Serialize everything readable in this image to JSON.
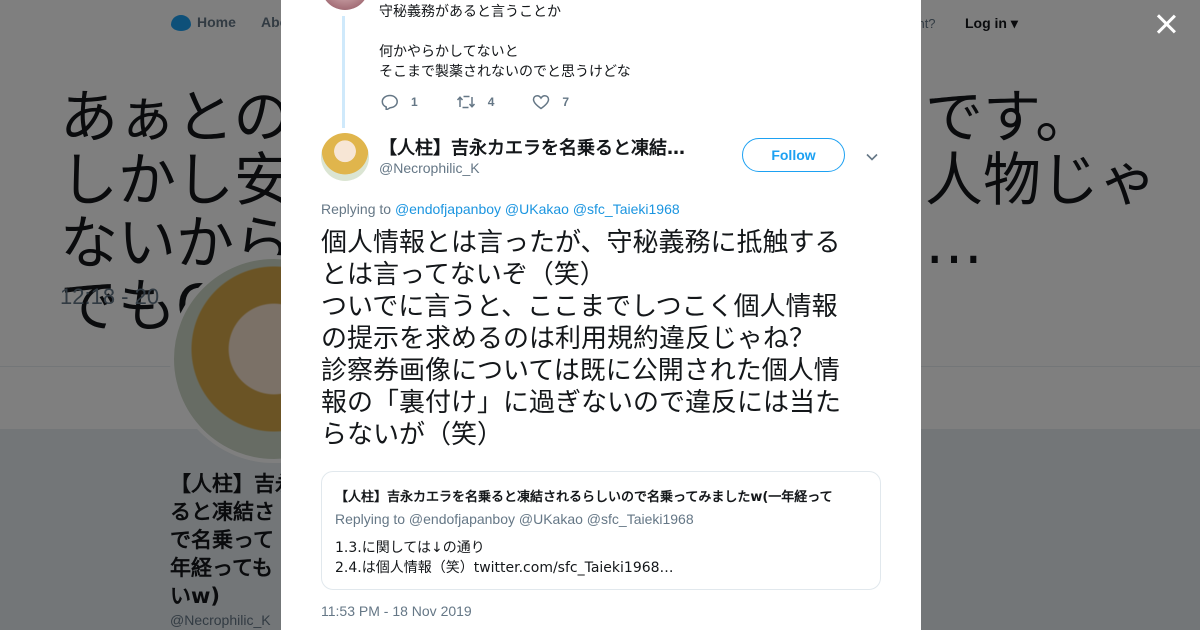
{
  "background": {
    "nav": {
      "home": "Home",
      "about": "Abo",
      "have_account": "ccount?",
      "login": "Log in"
    },
    "big_text_left": [
      "あぁとの",
      "しかし安",
      "ないから",
      "でもC庁に"
    ],
    "big_text_right": [
      "です。",
      "人物じゃ",
      "…"
    ],
    "time": "12:18 - 20",
    "profile_name": [
      "【人柱】吉永",
      "ると凍結さ",
      "で名乗って",
      "年経っても",
      "いw)"
    ],
    "profile_handle": "@Necrophilic_K"
  },
  "previous_tweet": {
    "lines": [
      "守秘義務があると言うことか",
      "",
      "何かやらかしてないと",
      "そこまで製薬されないのでと思うけどな"
    ],
    "actions": {
      "replies": "1",
      "retweets": "4",
      "likes": "7"
    }
  },
  "tweet": {
    "author_name": "【人柱】吉永カエラを名乗ると凍結…",
    "author_handle": "@Necrophilic_K",
    "follow_label": "Follow",
    "replying_prefix": "Replying to",
    "mentions": [
      "@endofjapanboy",
      "@UKakao",
      "@sfc_Taieki1968"
    ],
    "text_lines": [
      "個人情報とは言ったが、守秘義務に抵触する",
      "とは言ってないぞ（笑）",
      "ついでに言うと、ここまでしつこく個人情報",
      "の提示を求めるのは利用規約違反じゃね？",
      "診察券画像については既に公開された個人情",
      "報の「裏付け」に過ぎないので違反には当た",
      "らないが（笑）"
    ],
    "timestamp": "11:53 PM - 18 Nov 2019"
  },
  "quoted_tweet": {
    "name": "【人柱】吉永カエラを名乗ると凍結されるらしいので名乗ってみましたw(一年経って",
    "replying": "Replying to @endofjapanboy @UKakao @sfc_Taieki1968",
    "lines": [
      "1.3.に関しては↓の通り",
      "2.4.は個人情報（笑）twitter.com/sfc_Taieki1968…"
    ]
  },
  "colors": {
    "accent": "#1da1f2",
    "muted": "#657786",
    "text": "#14171a"
  },
  "icons": [
    "reply-icon",
    "retweet-icon",
    "like-icon",
    "chevron-down-icon",
    "close-icon",
    "twitter-bird-icon"
  ]
}
